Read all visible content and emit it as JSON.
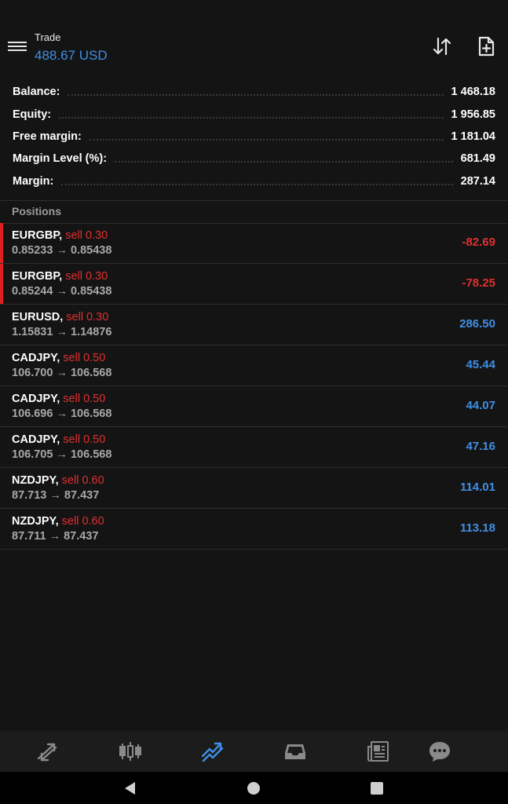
{
  "header": {
    "title": "Trade",
    "balance_line": "488.67 USD"
  },
  "icons": {
    "menu": "menu-icon",
    "sort": "sort-arrows-icon",
    "new_order": "new-document-icon"
  },
  "account": [
    {
      "label": "Balance:",
      "value": "1 468.18"
    },
    {
      "label": "Equity:",
      "value": "1 956.85"
    },
    {
      "label": "Free margin:",
      "value": "1 181.04"
    },
    {
      "label": "Margin Level (%):",
      "value": "681.49"
    },
    {
      "label": "Margin:",
      "value": "287.14"
    }
  ],
  "positions_header": "Positions",
  "positions": [
    {
      "symbol": "EURGBP,",
      "side": "sell 0.30",
      "prices": "0.85233 → 0.85438",
      "profit": "-82.69",
      "negative": true
    },
    {
      "symbol": "EURGBP,",
      "side": "sell 0.30",
      "prices": "0.85244 → 0.85438",
      "profit": "-78.25",
      "negative": true
    },
    {
      "symbol": "EURUSD,",
      "side": "sell 0.30",
      "prices": "1.15831 → 1.14876",
      "profit": "286.50",
      "negative": false
    },
    {
      "symbol": "CADJPY,",
      "side": "sell 0.50",
      "prices": "106.700 → 106.568",
      "profit": "45.44",
      "negative": false
    },
    {
      "symbol": "CADJPY,",
      "side": "sell 0.50",
      "prices": "106.696 → 106.568",
      "profit": "44.07",
      "negative": false
    },
    {
      "symbol": "CADJPY,",
      "side": "sell 0.50",
      "prices": "106.705 → 106.568",
      "profit": "47.16",
      "negative": false
    },
    {
      "symbol": "NZDJPY,",
      "side": "sell 0.60",
      "prices": "87.713 → 87.437",
      "profit": "114.01",
      "negative": false
    },
    {
      "symbol": "NZDJPY,",
      "side": "sell 0.60",
      "prices": "87.711 → 87.437",
      "profit": "113.18",
      "negative": false
    }
  ],
  "bottom_nav": [
    {
      "icon": "quotes-arrows-icon",
      "active": false
    },
    {
      "icon": "chart-candles-icon",
      "active": false
    },
    {
      "icon": "trade-icon",
      "active": true
    },
    {
      "icon": "history-inbox-icon",
      "active": false
    },
    {
      "icon": "news-icon",
      "active": false
    },
    {
      "icon": "chat-icon",
      "active": false
    }
  ],
  "colors": {
    "background": "#141414",
    "accent_blue": "#3f8fe6",
    "loss_red": "#e03030",
    "muted_text": "#a8a8a8"
  }
}
